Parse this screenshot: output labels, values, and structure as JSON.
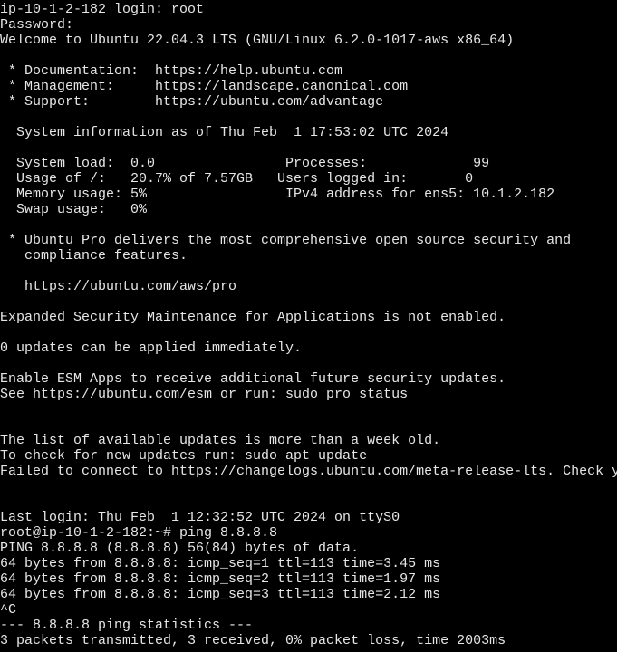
{
  "terminal": {
    "fg_color": "#e6e6e6",
    "bg_color": "#000000",
    "lines": [
      "ip-10-1-2-182 login: root",
      "Password:",
      "Welcome to Ubuntu 22.04.3 LTS (GNU/Linux 6.2.0-1017-aws x86_64)",
      "",
      " * Documentation:  https://help.ubuntu.com",
      " * Management:     https://landscape.canonical.com",
      " * Support:        https://ubuntu.com/advantage",
      "",
      "  System information as of Thu Feb  1 17:53:02 UTC 2024",
      "",
      "  System load:  0.0                Processes:             99",
      "  Usage of /:   20.7% of 7.57GB   Users logged in:       0",
      "  Memory usage: 5%                 IPv4 address for ens5: 10.1.2.182",
      "  Swap usage:   0%",
      "",
      " * Ubuntu Pro delivers the most comprehensive open source security and",
      "   compliance features.",
      "",
      "   https://ubuntu.com/aws/pro",
      "",
      "Expanded Security Maintenance for Applications is not enabled.",
      "",
      "0 updates can be applied immediately.",
      "",
      "Enable ESM Apps to receive additional future security updates.",
      "See https://ubuntu.com/esm or run: sudo pro status",
      "",
      "",
      "The list of available updates is more than a week old.",
      "To check for new updates run: sudo apt update",
      "Failed to connect to https://changelogs.ubuntu.com/meta-release-lts. Check y",
      "",
      "",
      "Last login: Thu Feb  1 12:32:52 UTC 2024 on ttyS0",
      "root@ip-10-1-2-182:~# ping 8.8.8.8",
      "PING 8.8.8.8 (8.8.8.8) 56(84) bytes of data.",
      "64 bytes from 8.8.8.8: icmp_seq=1 ttl=113 time=3.45 ms",
      "64 bytes from 8.8.8.8: icmp_seq=2 ttl=113 time=1.97 ms",
      "64 bytes from 8.8.8.8: icmp_seq=3 ttl=113 time=2.12 ms",
      "^C",
      "--- 8.8.8.8 ping statistics ---",
      "3 packets transmitted, 3 received, 0% packet loss, time 2003ms"
    ]
  }
}
